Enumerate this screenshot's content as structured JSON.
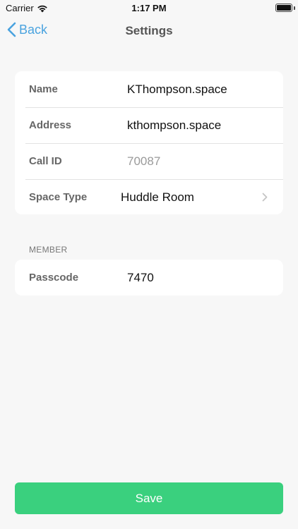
{
  "status_bar": {
    "carrier": "Carrier",
    "time": "1:17 PM",
    "battery_level": 1.0
  },
  "nav": {
    "back_label": "Back",
    "title": "Settings"
  },
  "fields": [
    {
      "label": "Name",
      "value": "KThompson.space"
    },
    {
      "label": "Address",
      "value": "kthompson.space"
    },
    {
      "label": "Call ID",
      "value": "70087"
    },
    {
      "label": "Space Type",
      "value": "Huddle Room"
    }
  ],
  "member": {
    "header": "MEMBER",
    "fields": [
      {
        "label": "Passcode",
        "value": "7470"
      }
    ]
  },
  "save_label": "Save",
  "colors": {
    "accent": "#4aa3df",
    "save": "#3ad07e",
    "background": "#f7f7f7"
  },
  "icons": {
    "back": "chevron-left-icon",
    "disclosure": "chevron-right-icon",
    "wifi": "wifi-icon",
    "battery": "battery-icon"
  }
}
